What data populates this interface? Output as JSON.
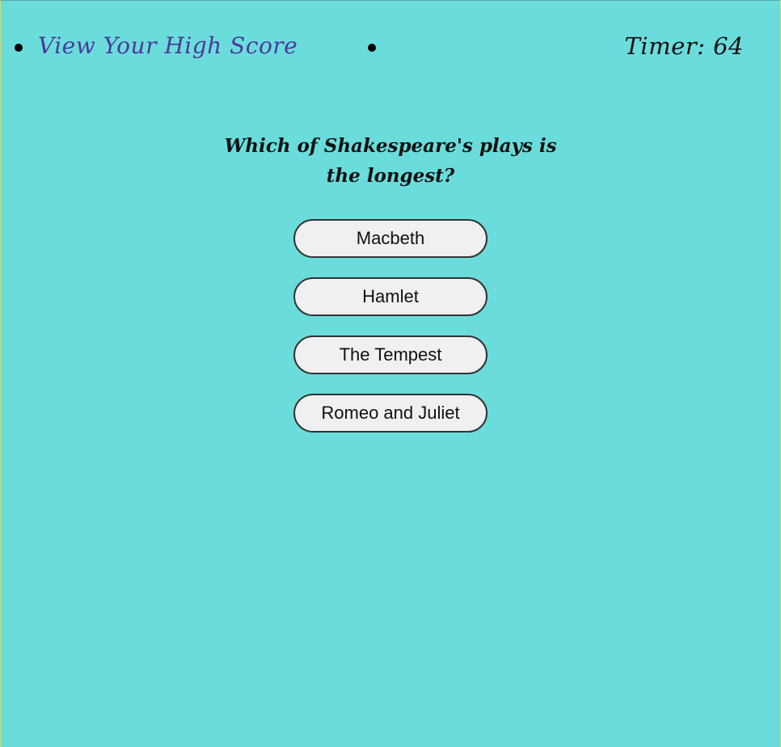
{
  "nav": {
    "high_score_link": "View Your High Score",
    "timer_label": "Timer: 64"
  },
  "quiz": {
    "question": "Which of Shakespeare's plays is the longest?",
    "answers": [
      "Macbeth",
      "Hamlet",
      "The Tempest",
      "Romeo and Juliet"
    ]
  },
  "colors": {
    "background": "#6bdcdc",
    "link": "#4b3a9a",
    "button_bg": "#f0f0f0"
  }
}
